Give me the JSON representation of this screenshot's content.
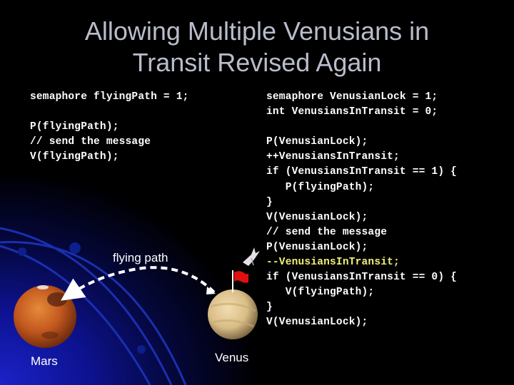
{
  "slide": {
    "title_line1": "Allowing Multiple Venusians in",
    "title_line2": "Transit Revised Again"
  },
  "code_left": [
    {
      "text": "semaphore flyingPath = 1;",
      "highlight": false
    },
    {
      "text": "",
      "highlight": false
    },
    {
      "text": "P(flyingPath);",
      "highlight": false
    },
    {
      "text": "// send the message",
      "highlight": false
    },
    {
      "text": "V(flyingPath);",
      "highlight": false
    }
  ],
  "code_right": [
    {
      "text": "semaphore VenusianLock = 1;",
      "highlight": false
    },
    {
      "text": "int VenusiansInTransit = 0;",
      "highlight": false
    },
    {
      "text": "",
      "highlight": false
    },
    {
      "text": "P(VenusianLock);",
      "highlight": false
    },
    {
      "text": "++VenusiansInTransit;",
      "highlight": false
    },
    {
      "text": "if (VenusiansInTransit == 1) {",
      "highlight": false
    },
    {
      "text": "   P(flyingPath);",
      "highlight": false
    },
    {
      "text": "}",
      "highlight": false
    },
    {
      "text": "V(VenusianLock);",
      "highlight": false
    },
    {
      "text": "// send the message",
      "highlight": false
    },
    {
      "text": "P(VenusianLock);",
      "highlight": false
    },
    {
      "text": "--VenusiansInTransit;",
      "highlight": true
    },
    {
      "text": "if (VenusiansInTransit == 0) {",
      "highlight": false
    },
    {
      "text": "   V(flyingPath);",
      "highlight": false
    },
    {
      "text": "}",
      "highlight": false
    },
    {
      "text": "V(VenusianLock);",
      "highlight": false
    }
  ],
  "diagram": {
    "path_label": "flying path",
    "mars_label": "Mars",
    "venus_label": "Venus",
    "icons": {
      "mars": "planet-mars-icon",
      "venus": "planet-venus-icon",
      "flag": "red-flag-icon",
      "spaceship": "spaceship-icon"
    }
  },
  "colors": {
    "title": "#b9bccb",
    "code": "#ffffff",
    "code_highlight": "#f0f07a",
    "flag": "#e01010"
  }
}
